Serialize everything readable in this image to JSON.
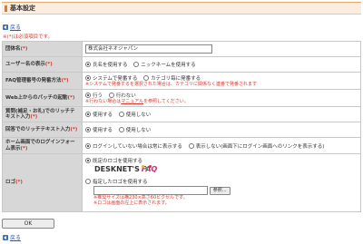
{
  "page": {
    "title": "基本設定"
  },
  "nav": {
    "back_label": "戻る"
  },
  "note_required": "※(*)は必須項目です。",
  "rows": {
    "company": {
      "label": "団体名",
      "required": "(*)",
      "value": "株式会社ネオジャパン"
    },
    "username": {
      "label": "ユーザー名の表示",
      "required": "(*)",
      "opt1": "氏名を使用する",
      "opt2": "ニックネームを使用する"
    },
    "faq": {
      "label": "FAQ管理番号の発番方法",
      "required": "(*)",
      "opt1": "システムで発番する",
      "opt2": "カテゴリ毎に発番する",
      "note": "※システムで発番するを選択された場合は、カテゴリに関係なく連番で発番されます"
    },
    "patch": {
      "label": "Web上からのパッチの起動",
      "required": "(*)",
      "opt1": "行う",
      "opt2": "行わない",
      "note_pre": "※行わない場合は",
      "note_link": "マニュアル",
      "note_post": "を参照してください。"
    },
    "richtext_q": {
      "label": "質問(補足・お礼)でのリッチテキスト入力",
      "required": "(*)",
      "opt1": "使用する",
      "opt2": "使用しない"
    },
    "richtext_a": {
      "label": "回答でのリッチテキスト入力",
      "required": "(*)",
      "opt1": "使用する",
      "opt2": "使用しない"
    },
    "login_form": {
      "label": "ホーム画面でのログインフォーム表示",
      "required": "(*)",
      "opt1": "ログインしていない場合は常に表示する",
      "opt2": "表示しない(画面下にログイン画面へのリンクを表示する)"
    },
    "logo": {
      "label": "ロゴ",
      "required": "(*)",
      "opt1": "既定のロゴを使用する",
      "logo_word1": "DESKNET'S",
      "logo_word2": "FAQ",
      "opt2": "指定したロゴを使用する",
      "browse_label": "参照...",
      "note1": "※推奨サイズは横230×高さ60ピクセルです。",
      "note2": "※ロゴは画面の左上に表示されます。"
    }
  },
  "actions": {
    "ok_label": "OK"
  },
  "colors": {
    "accent": "#e07a26",
    "label_bg": "#d7d7d7",
    "required_red": "#d9352b",
    "link_blue": "#2a56b0"
  }
}
